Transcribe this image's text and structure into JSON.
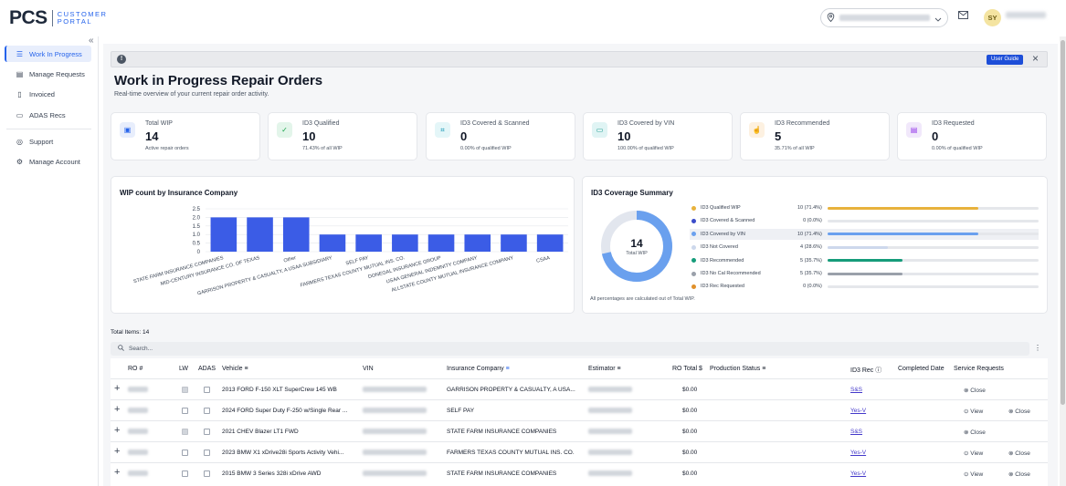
{
  "header": {
    "logo_main": "PCS",
    "logo_line1": "CUSTOMER",
    "logo_line2": "PORTAL",
    "user_initials": "SY"
  },
  "sidebar": {
    "items": [
      {
        "label": "Work In Progress",
        "icon": "list-icon",
        "active": true
      },
      {
        "label": "Manage Requests",
        "icon": "requests-icon",
        "active": false
      },
      {
        "label": "Invoiced",
        "icon": "document-icon",
        "active": false
      },
      {
        "label": "ADAS Recs",
        "icon": "car-icon",
        "active": false
      },
      {
        "label": "Support",
        "icon": "support-icon",
        "active": false
      },
      {
        "label": "Manage Account",
        "icon": "gear-icon",
        "active": false
      }
    ]
  },
  "banner": {
    "user_guide_label": "User Guide"
  },
  "page": {
    "title": "Work in Progress Repair Orders",
    "subtitle": "Real-time overview of your current repair order activity."
  },
  "cards": [
    {
      "label": "Total WIP",
      "value": "14",
      "note": "Active repair orders",
      "icon": "clipboard-icon",
      "bg": "#e8eefc",
      "fg": "#2563eb"
    },
    {
      "label": "ID3 Qualified",
      "value": "10",
      "note": "71.43% of all WIP",
      "icon": "shield-check-icon",
      "bg": "#e3f5ea",
      "fg": "#16a34a"
    },
    {
      "label": "ID3 Covered & Scanned",
      "value": "0",
      "note": "0.00% of qualified WIP",
      "icon": "scan-icon",
      "bg": "#e4f6f8",
      "fg": "#0891b2"
    },
    {
      "label": "ID3 Covered by VIN",
      "value": "10",
      "note": "100.00% of qualified WIP",
      "icon": "car-icon",
      "bg": "#e0f4f4",
      "fg": "#0d9488"
    },
    {
      "label": "ID3 Recommended",
      "value": "5",
      "note": "35.71% of all WIP",
      "icon": "thumbs-up-icon",
      "bg": "#fdf1e1",
      "fg": "#ea580c"
    },
    {
      "label": "ID3 Requested",
      "value": "0",
      "note": "0.00% of qualified WIP",
      "icon": "file-icon",
      "bg": "#f1e8fb",
      "fg": "#9333ea"
    }
  ],
  "chart_data": {
    "type": "bar",
    "title": "WIP count by Insurance Company",
    "categories": [
      "STATE FARM INSURANCE COMPANIES",
      "MID-CENTURY INSURANCE CO. OF TEXAS",
      "Other",
      "GARRISON PROPERTY & CASUALTY, A USAA SUBSIDIARY",
      "SELF PAY",
      "FARMERS TEXAS COUNTY MUTUAL INS. CO.",
      "DONEGAL INSURANCE GROUP",
      "USAA GENERAL INDEMNITY COMPANY",
      "ALLSTATE COUNTY MUTUAL INSURANCE COMPANY",
      "CSAA"
    ],
    "values": [
      2,
      2,
      2,
      1,
      1,
      1,
      1,
      1,
      1,
      1
    ],
    "yticks": [
      "0",
      "0.5",
      "1.0",
      "1.5",
      "2.0",
      "2.5"
    ],
    "ylim": [
      0,
      2.5
    ],
    "color": "#3b5ce6",
    "grid": true
  },
  "coverage": {
    "title": "ID3 Coverage Summary",
    "donut_value": "14",
    "donut_label": "Total WIP",
    "donut_fraction": 0.714,
    "note": "All percentages are calculated out of Total WIP.",
    "rows": [
      {
        "name": "ID3 Qualified WIP",
        "value": "10 (71.4%)",
        "pct": 71.4,
        "color": "#e8b23c"
      },
      {
        "name": "ID3 Covered & Scanned",
        "value": "0 (0.0%)",
        "pct": 0,
        "color": "#3b4cca"
      },
      {
        "name": "ID3 Covered by VIN",
        "value": "10 (71.4%)",
        "pct": 71.4,
        "color": "#6aa0ee"
      },
      {
        "name": "ID3 Not Covered",
        "value": "4 (28.6%)",
        "pct": 28.6,
        "color": "#cdd8ec"
      },
      {
        "name": "ID3 Recommended",
        "value": "5 (35.7%)",
        "pct": 35.7,
        "color": "#169c7a"
      },
      {
        "name": "ID3 No Cal Recommended",
        "value": "5 (35.7%)",
        "pct": 35.7,
        "color": "#9aa0aa"
      },
      {
        "name": "ID3 Rec Requested",
        "value": "0 (0.0%)",
        "pct": 0,
        "color": "#e0902a"
      }
    ]
  },
  "table": {
    "total_items": "Total Items: 14",
    "search_placeholder": "Search...",
    "headers": {
      "ro": "RO #",
      "lw": "LW",
      "adas": "ADAS",
      "vehicle": "Vehicle",
      "vin": "VIN",
      "insurance": "Insurance Company",
      "estimator": "Estimator",
      "ro_total": "RO Total $",
      "production_status": "Production Status",
      "id3_rec": "ID3 Rec",
      "completed_date": "Completed Date",
      "service_requests": "Service Requests"
    },
    "rows": [
      {
        "lw": true,
        "adas": false,
        "vehicle": "2013 FORD F-150 XLT SuperCrew 145 WB",
        "insurance": "GARRISON PROPERTY & CASUALTY, A USA...",
        "total": "$0.00",
        "id3_rec": "S&S",
        "view": "",
        "close": "Close"
      },
      {
        "lw": false,
        "adas": false,
        "vehicle": "2024 FORD Super Duty F-250 w/Single Rear ...",
        "insurance": "SELF PAY",
        "total": "$0.00",
        "id3_rec": "Yes-V",
        "view": "View",
        "close": "Close"
      },
      {
        "lw": true,
        "adas": false,
        "vehicle": "2021 CHEV Blazer LT1 FWD",
        "insurance": "STATE FARM INSURANCE COMPANIES",
        "total": "$0.00",
        "id3_rec": "S&S",
        "view": "",
        "close": "Close"
      },
      {
        "lw": false,
        "adas": false,
        "vehicle": "2023 BMW X1 xDrive28i Sports Activity Vehi...",
        "insurance": "FARMERS TEXAS COUNTY MUTUAL INS. CO.",
        "total": "$0.00",
        "id3_rec": "Yes-V",
        "view": "View",
        "close": "Close"
      },
      {
        "lw": false,
        "adas": false,
        "vehicle": "2015 BMW 3 Series 328i xDrive AWD",
        "insurance": "STATE FARM INSURANCE COMPANIES",
        "total": "$0.00",
        "id3_rec": "Yes-V",
        "view": "View",
        "close": "Close"
      }
    ]
  }
}
